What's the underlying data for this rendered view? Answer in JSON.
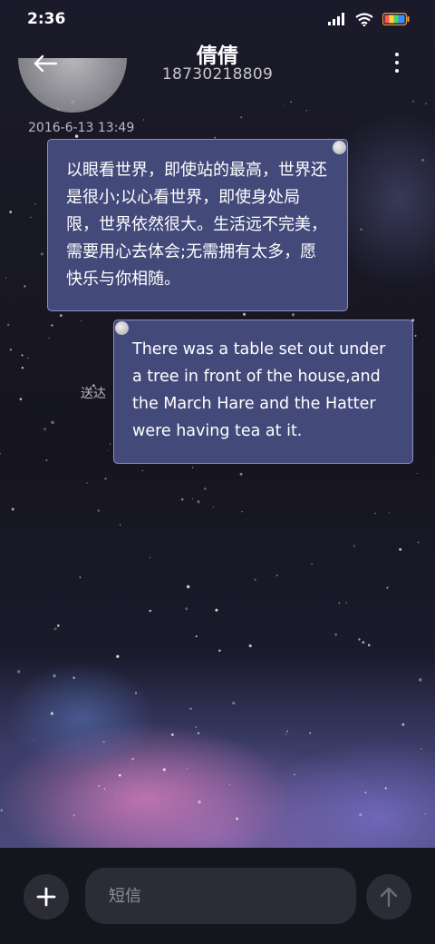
{
  "status_bar": {
    "time": "2:36",
    "icons": [
      "signal-icon",
      "wifi-icon",
      "battery-icon"
    ]
  },
  "header": {
    "contact_name": "倩倩",
    "contact_number": "18730218809",
    "back_icon": "back-arrow-icon",
    "more_icon": "more-vertical-icon"
  },
  "conversation": {
    "timestamp": "2016-6-13 13:49",
    "messages": [
      {
        "direction": "incoming",
        "text": "以眼看世界，即使站的最高，世界还是很小;以心看世界，即使身处局限，世界依然很大。生活远不完美，需要用心去体会;无需拥有太多，愿快乐与你相随。"
      },
      {
        "direction": "outgoing",
        "text": "There was a table set out under a tree in front of the house,and the March Hare and the Hatter were having tea at it.",
        "status": "送达"
      }
    ]
  },
  "composer": {
    "placeholder": "短信",
    "value": "",
    "add_icon": "plus-icon",
    "send_icon": "send-arrow-icon"
  },
  "colors": {
    "bubble_fill": "#434a7a",
    "bubble_border": "#8a90c0",
    "background": "#15141f",
    "composer_fill": "#2c2c36"
  }
}
